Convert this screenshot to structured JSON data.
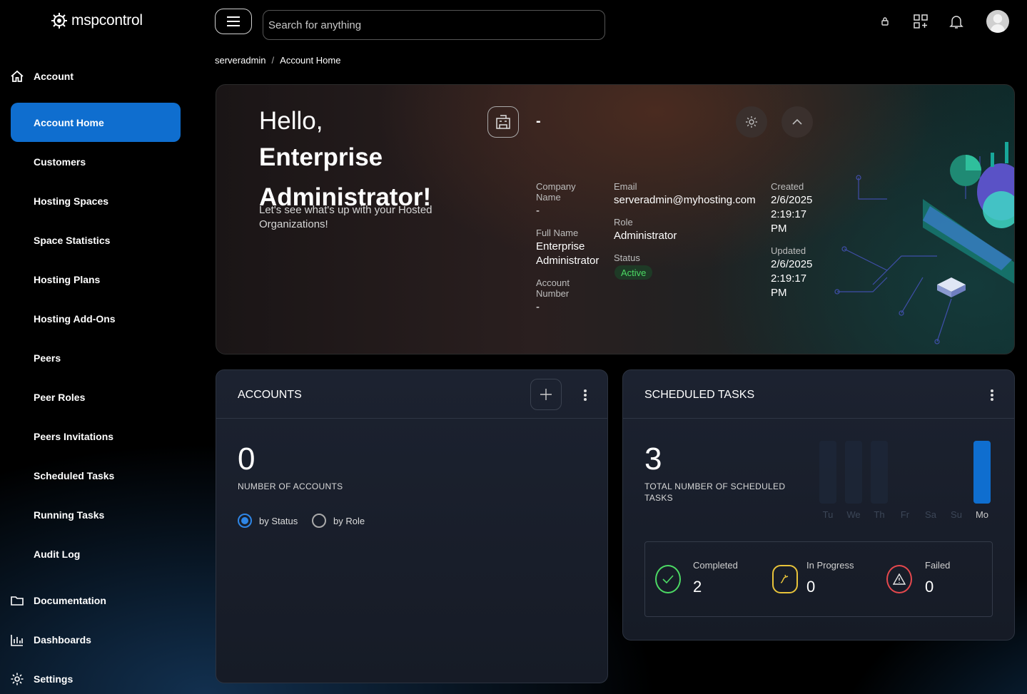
{
  "app": {
    "logo_text": "mspcontrol"
  },
  "topbar": {
    "search_placeholder": "Search for anything"
  },
  "sidebar": {
    "section_account": "Account",
    "items": [
      {
        "label": "Account Home",
        "active": true
      },
      {
        "label": "Customers"
      },
      {
        "label": "Hosting Spaces"
      },
      {
        "label": "Space Statistics"
      },
      {
        "label": "Hosting Plans"
      },
      {
        "label": "Hosting Add-Ons"
      },
      {
        "label": "Peers"
      },
      {
        "label": "Peer Roles"
      },
      {
        "label": "Peers Invitations"
      },
      {
        "label": "Scheduled Tasks"
      },
      {
        "label": "Running Tasks"
      },
      {
        "label": "Audit Log"
      }
    ],
    "section_documentation": "Documentation",
    "section_dashboards": "Dashboards",
    "section_settings": "Settings"
  },
  "breadcrumb": {
    "root": "serveradmin",
    "separator": "/",
    "current": "Account Home"
  },
  "hero": {
    "greeting": "Hello,",
    "name": "Enterprise Administrator!",
    "subtitle": "Let's see what's up with your Hosted Organizations!",
    "org_name": "-",
    "company_name_label": "Company Name",
    "company_name_value": "-",
    "full_name_label": "Full Name",
    "full_name_value": "Enterprise Administrator",
    "account_number_label": "Account Number",
    "account_number_value": "-",
    "email_label": "Email",
    "email_value": "serveradmin@myhosting.com",
    "role_label": "Role",
    "role_value": "Administrator",
    "status_label": "Status",
    "status_value": "Active",
    "created_label": "Created",
    "created_value": "2/6/2025 2:19:17 PM",
    "updated_label": "Updated",
    "updated_value": "2/6/2025 2:19:17 PM",
    "status_color": "#4cd964"
  },
  "accounts_card": {
    "title": "ACCOUNTS",
    "count": "0",
    "count_label": "NUMBER OF ACCOUNTS",
    "radio_status": "by Status",
    "radio_role": "by Role",
    "selected": "by Status"
  },
  "tasks_card": {
    "title": "SCHEDULED TASKS",
    "count": "3",
    "count_label": "TOTAL NUMBER OF SCHEDULED TASKS",
    "chart_days": [
      "Tu",
      "We",
      "Th",
      "Fr",
      "Sa",
      "Su",
      "Mo"
    ],
    "completed_label": "Completed",
    "completed_value": "2",
    "in_progress_label": "In Progress",
    "in_progress_value": "0",
    "failed_label": "Failed",
    "failed_value": "0",
    "colors": {
      "completed": "#4cd964",
      "in_progress": "#e8c33a",
      "failed": "#e5484d",
      "accent": "#0f6ecf"
    }
  },
  "chart_data": {
    "type": "bar",
    "categories": [
      "Tu",
      "We",
      "Th",
      "Fr",
      "Sa",
      "Su",
      "Mo"
    ],
    "series": [
      {
        "values": [
          0,
          0,
          0,
          0,
          0,
          0,
          3
        ]
      }
    ]
  }
}
